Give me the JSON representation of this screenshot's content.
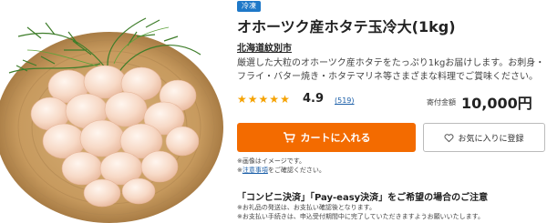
{
  "product": {
    "badge": "冷凍",
    "title": "オホーツク産ホタテ玉冷大(1kg)",
    "municipality": "北海道紋別市",
    "description_lines": [
      "厳選した大粒のオホーツク産ホタテをたっぷり1kgお届けします。お刺身・",
      "フライ・バター焼き・ホタテマリネ等さまざまな料理でご賞味ください。"
    ],
    "rating": {
      "stars_filled": 5,
      "stars_total": 5,
      "score": "4.9",
      "review_count": "(519)"
    },
    "price_label": "寄付金額",
    "price": "10,000円"
  },
  "actions": {
    "cart_label": "カートに入れる",
    "favorite_label": "お気に入りに登録"
  },
  "notes": {
    "line1": "※画像はイメージです。",
    "line2_prefix": "※",
    "line2_link": "注意事項",
    "line2_suffix": "をご確認ください。"
  },
  "payment": {
    "heading": "「コンビニ決済」「Pay-easy決済」をご希望の場合のご注意",
    "line1": "※お礼品の発送は、お支払い確認後となります。",
    "line2": "※お支払い手続きは、申込受付期間中に完了していただきますようお願いいたします。"
  },
  "colors": {
    "badge": "#1e78c8",
    "cart_button": "#f36b00",
    "stars": "#f5a200",
    "link": "#1a5ea8"
  },
  "icons": {
    "cart": "cart-icon",
    "favorite": "heart-outline-icon",
    "stars": "star-icon"
  }
}
